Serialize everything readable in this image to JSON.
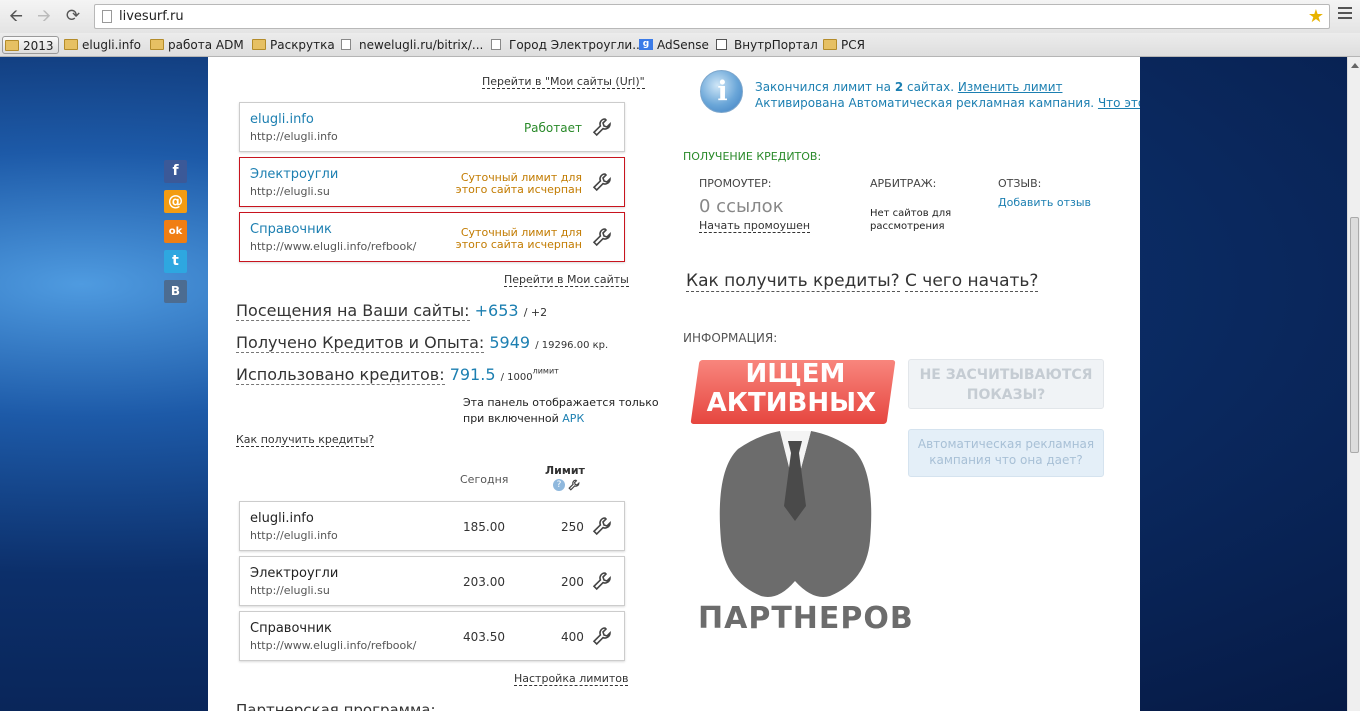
{
  "browser": {
    "url": "livesurf.ru"
  },
  "bookmarks": [
    {
      "label": "2013",
      "icon": "folder-icon"
    },
    {
      "label": "elugli.info",
      "icon": "folder-icon"
    },
    {
      "label": "работа ADM",
      "icon": "folder-icon"
    },
    {
      "label": "Раскрутка",
      "icon": "folder-icon"
    },
    {
      "label": "newelugli.ru/bitrix/...",
      "icon": "page-icon"
    },
    {
      "label": "Город Электроугли...",
      "icon": "page-icon"
    },
    {
      "label": "AdSense",
      "icon": "google-icon"
    },
    {
      "label": "ВнутрПортал",
      "icon": "document-icon"
    },
    {
      "label": "РСЯ",
      "icon": "folder-icon"
    }
  ],
  "social": {
    "fb": "f",
    "mail": "@",
    "ok": "ok",
    "tw": "t",
    "vk": "B"
  },
  "sites": {
    "link_my_sites_url": "Перейти в \"Мои сайты (Url)\"",
    "items": [
      {
        "name": "elugli.info",
        "url": "http://elugli.info",
        "status": "Работает"
      },
      {
        "name": "Электроугли",
        "url": "http://elugli.su",
        "status_l1": "Суточный лимит для",
        "status_l2": "этого сайта исчерпан"
      },
      {
        "name": "Справочник",
        "url": "http://www.elugli.info/refbook/",
        "status_l1": "Суточный лимит для",
        "status_l2": "этого сайта исчерпан"
      }
    ],
    "link_my_sites": "Перейти в Мои сайты"
  },
  "stats": {
    "visits_label": "Посещения на Ваши сайты:",
    "visits_value": "+653",
    "visits_extra": "/ +2",
    "credits_label": "Получено Кредитов и Опыта:",
    "credits_value": "5949",
    "credits_extra": "/ 19296.00 кр.",
    "used_label": "Использовано кредитов:",
    "used_value": "791.5",
    "used_extra": "/ 1000",
    "used_sup": "лимит",
    "panel_note_1": "Эта панель отображается только",
    "panel_note_2": "при включенной",
    "panel_note_apk": "АРК",
    "how_link": "Как получить кредиты?"
  },
  "limits": {
    "col_today": "Сегодня",
    "col_limit": "Лимит",
    "rows": [
      {
        "name": "elugli.info",
        "url": "http://elugli.info",
        "today": "185.00",
        "limit": "250"
      },
      {
        "name": "Электроугли",
        "url": "http://elugli.su",
        "today": "203.00",
        "limit": "200"
      },
      {
        "name": "Справочник",
        "url": "http://www.elugli.info/refbook/",
        "today": "403.50",
        "limit": "400"
      }
    ],
    "settings_link": "Настройка лимитов",
    "partner_program": "Партнерская программа:"
  },
  "notice": {
    "line1_a": "Закончился лимит на",
    "line1_num": "2",
    "line1_b": "сайтах.",
    "change_limit": "Изменить лимит",
    "line2": "Активирована Автоматическая рекламная кампания.",
    "what": "Что это?"
  },
  "credits_get": {
    "title": "ПОЛУЧЕНИЕ КРЕДИТОВ:",
    "promo_label": "ПРОМОУТЕР:",
    "promo_value": "0 ссылок",
    "promo_link": "Начать промоушен",
    "arb_label": "АРБИТРАЖ:",
    "arb_text_1": "Нет сайтов для",
    "arb_text_2": "рассмотрения",
    "review_label": "ОТЗЫВ:",
    "review_link": "Добавить отзыв"
  },
  "help_links": {
    "how": "Как получить кредиты?",
    "start": "С чего начать?"
  },
  "info": {
    "title": "ИНФОРМАЦИЯ:",
    "banner_l1": "ИЩЕМ",
    "banner_l2": "АКТИВНЫХ",
    "banner_l3": "ПАРТНЕРОВ",
    "btn1_l1": "НЕ ЗАСЧИТЫВАЮТСЯ",
    "btn1_l2": "ПОКАЗЫ?",
    "btn2_l1": "Автоматическая рекламная",
    "btn2_l2": "кампания что она дает?"
  }
}
